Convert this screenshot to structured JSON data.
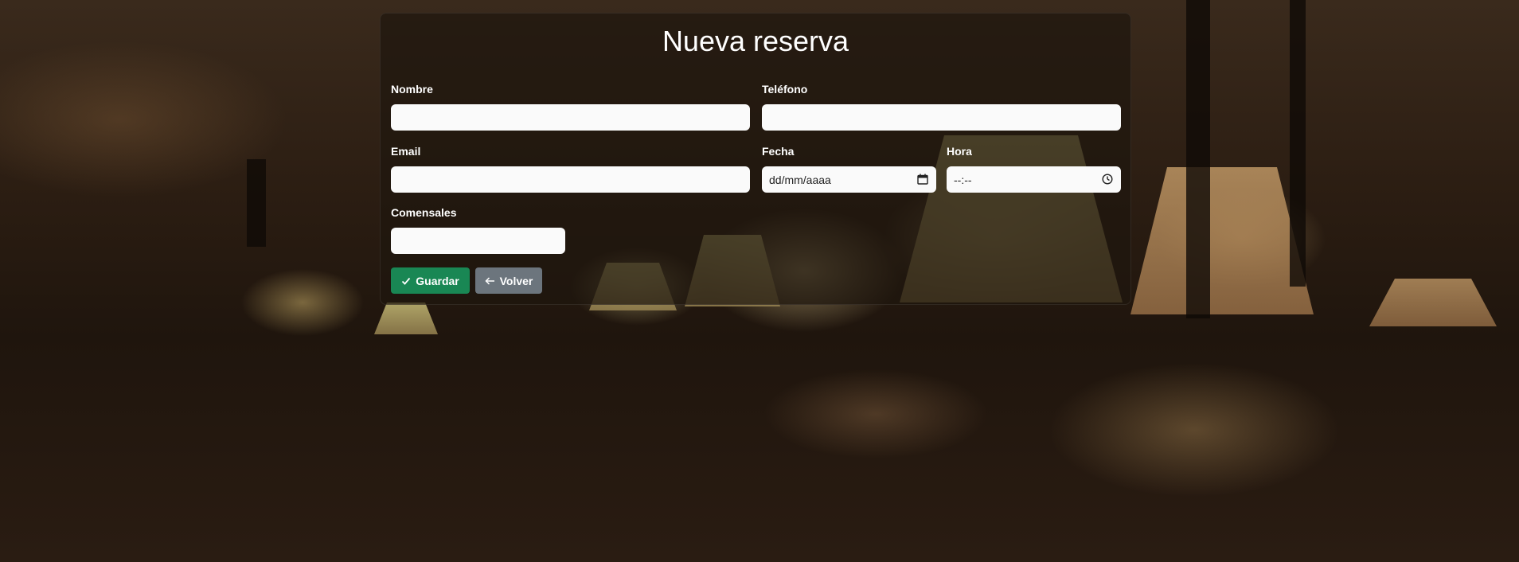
{
  "form": {
    "title": "Nueva reserva",
    "fields": {
      "nombre": {
        "label": "Nombre",
        "value": ""
      },
      "telefono": {
        "label": "Teléfono",
        "value": ""
      },
      "email": {
        "label": "Email",
        "value": ""
      },
      "fecha": {
        "label": "Fecha",
        "placeholder": "dd/mm/aaaa",
        "icon": "calendar-icon"
      },
      "hora": {
        "label": "Hora",
        "placeholder": "--:--",
        "icon": "clock-icon"
      },
      "comensales": {
        "label": "Comensales",
        "value": ""
      }
    },
    "buttons": {
      "save": {
        "label": "Guardar",
        "icon": "check-icon",
        "color": "#198754"
      },
      "back": {
        "label": "Volver",
        "icon": "arrow-left-icon",
        "color": "#6c757d"
      }
    }
  }
}
